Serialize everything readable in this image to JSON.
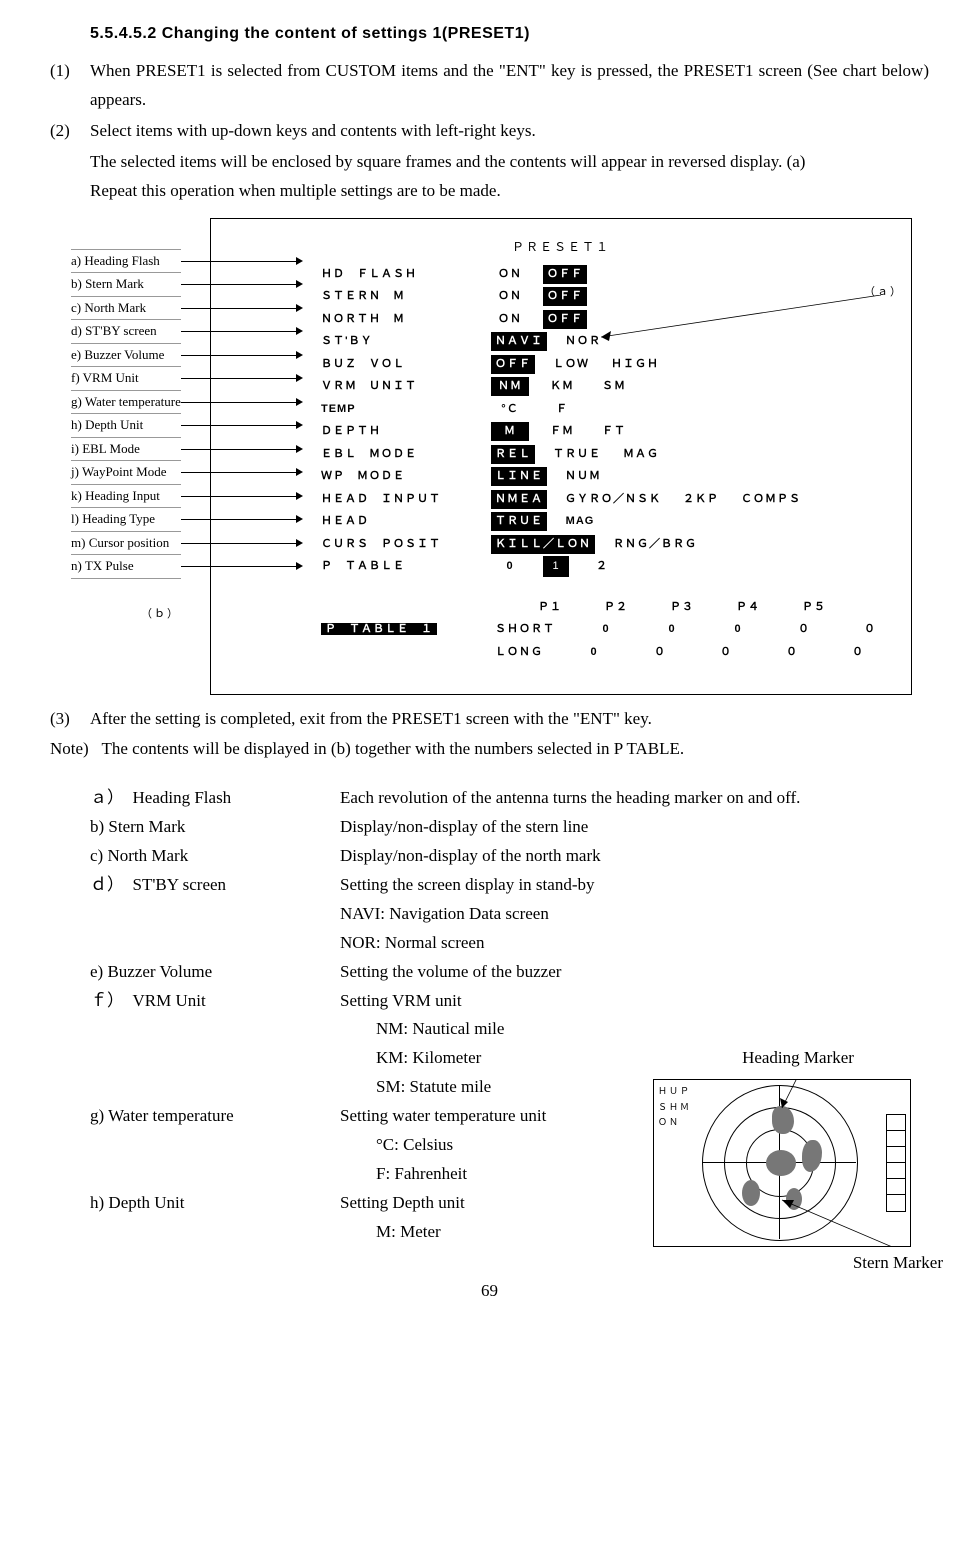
{
  "section_number": "5.5.4.5.2",
  "section_title": "Changing the content of settings 1(PRESET1)",
  "steps": {
    "1": "When PRESET1 is selected from CUSTOM items and the \"ENT\" key is pressed, the PRESET1 screen (See chart below) appears.",
    "2": "Select items with up-down keys and contents with left-right keys.",
    "2a": "The selected items will be enclosed by square frames and the contents will appear in reversed display. (a)",
    "2b": "Repeat this operation when multiple settings are to be made.",
    "3": "After the setting is completed, exit from the PRESET1 screen with the \"ENT\" key."
  },
  "note": "The contents will be displayed in (b) together with the numbers selected in P TABLE.",
  "legend": [
    "a) Heading Flash",
    "b) Stern Mark",
    "c) North Mark",
    "d) ST'BY screen",
    "e) Buzzer Volume",
    "f) VRM Unit",
    "g) Water temperature",
    "h) Depth Unit",
    "i) EBL Mode",
    "j) WayPoint Mode",
    "k) Heading Input",
    "l) Heading Type",
    "m) Cursor position",
    "n) TX Pulse"
  ],
  "screen_rows": [
    {
      "lbl": "ＨＤ　ＦＬＡＳＨ",
      "opts": [
        "ＯＮ",
        "ＯＦＦ"
      ],
      "sel": 1
    },
    {
      "lbl": "ＳＴＥＲＮ　Ｍ",
      "opts": [
        "ＯＮ",
        "ＯＦＦ"
      ],
      "sel": 1
    },
    {
      "lbl": "ＮＯＲＴＨ　Ｍ",
      "opts": [
        "ＯＮ",
        "ＯＦＦ"
      ],
      "sel": 1
    },
    {
      "lbl": "ＳＴ'ＢＹ",
      "opts": [
        "ＮＡＶＩ",
        "ＮＯＲ"
      ],
      "sel": 0
    },
    {
      "lbl": "ＢＵＺ　ＶＯＬ",
      "opts": [
        "ＯＦＦ",
        "ＬＯＷ",
        "ＨＩＧＨ"
      ],
      "sel": 0
    },
    {
      "lbl": "ＶＲＭ　ＵＮＩＴ",
      "opts": [
        "ＮＭ",
        "ＫＭ",
        "ＳＭ"
      ],
      "sel": 0
    },
    {
      "lbl": "TEMP",
      "opts": [
        "°Ｃ",
        "Ｆ"
      ],
      "sel": -1
    },
    {
      "lbl": "ＤＥＰＴＨ",
      "opts": [
        "Ｍ",
        "ＦＭ",
        "ＦＴ"
      ],
      "sel": 0
    },
    {
      "lbl": "ＥＢＬ　ＭＯＤＥ",
      "opts": [
        "ＲＥＬ",
        "ＴＲＵＥ",
        "ＭＡＧ"
      ],
      "sel": 0
    },
    {
      "lbl": "ＷＰ　ＭＯＤＥ",
      "opts": [
        "ＬＩＮＥ",
        "ＮＵＭ"
      ],
      "sel": 0
    },
    {
      "lbl": "ＨＥＡＤ　ＩＮＰＵＴ",
      "opts": [
        "ＮＭＥＡ",
        "ＧＹＲＯ／ＮＳＫ",
        "２ＫＰ",
        "ＣＯＭＰＳ"
      ],
      "sel": 0
    },
    {
      "lbl": "ＨＥＡＤ",
      "opts": [
        "ＴＲＵＥ",
        "MAG"
      ],
      "sel": 0
    },
    {
      "lbl": "ＣＵＲＳ　ＰＯＳＩＴ",
      "opts": [
        "ＫＩＬＬ／ＬＯＮ",
        "ＲＮＧ／ＢＲＧ"
      ],
      "sel": 0
    },
    {
      "lbl": "Ｐ　ＴＡＢＬＥ",
      "opts": [
        "0",
        "1",
        "２"
      ],
      "sel": -1
    }
  ],
  "bottom_row1": {
    "lbl": "Ｐ　ＴＡＢＬＥ　１",
    "hdr": [
      "Ｐ１",
      "Ｐ２",
      "Ｐ３",
      "Ｐ４",
      "Ｐ５"
    ]
  },
  "bottom_row2": {
    "lbl": "",
    "pre": "ＳＨＯＲＴ",
    "vals": [
      "0",
      "0",
      "0",
      "０",
      "０"
    ]
  },
  "bottom_row3": {
    "lbl": "",
    "pre": "ＬＯＮＧ",
    "vals": [
      "0",
      "０",
      "０",
      "０",
      "０"
    ]
  },
  "defs": [
    {
      "key": "ａ）　Heading Flash",
      "val": "Each revolution of the antenna turns the heading marker on and off."
    },
    {
      "key": "b) Stern Mark",
      "val": "Display/non-display of the stern line"
    },
    {
      "key": "c) North Mark",
      "val": "Display/non-display of the north mark"
    },
    {
      "key": "ｄ）　ST'BY screen",
      "val": "Setting the screen display in stand-by"
    },
    {
      "key": "",
      "val": "NAVI: Navigation Data screen"
    },
    {
      "key": "",
      "val": "NOR: Normal screen"
    },
    {
      "key": "e) Buzzer Volume",
      "val": "Setting the volume of the buzzer"
    },
    {
      "key": "ｆ）　VRM Unit",
      "val": "Setting VRM unit"
    },
    {
      "key": "",
      "val": "NM: Nautical mile",
      "sub": true
    },
    {
      "key": "",
      "val": "KM: Kilometer",
      "sub": true
    },
    {
      "key": "",
      "val": "SM: Statute mile",
      "sub": true
    },
    {
      "key": "g)  Water temperature",
      "val": "Setting water temperature unit"
    },
    {
      "key": "",
      "val": "°C: Celsius",
      "sub": true
    },
    {
      "key": "",
      "val": "F: Fahrenheit",
      "sub": true
    },
    {
      "key": "",
      "val": ""
    },
    {
      "key": "h) Depth Unit",
      "val": "Setting Depth unit"
    },
    {
      "key": "",
      "val": "M: Meter",
      "sub": true
    }
  ],
  "radar": {
    "label_top": "Heading Marker",
    "label_bottom": "Stern Marker"
  },
  "page": "69"
}
